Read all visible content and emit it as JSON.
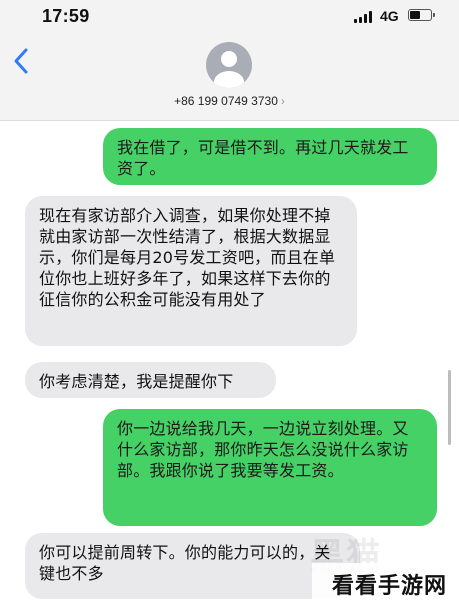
{
  "status_bar": {
    "time": "17:59",
    "network": "4G",
    "battery_level": 0.55
  },
  "header": {
    "contact": "+86 199 0749 3730",
    "chevron": "›"
  },
  "messages": [
    {
      "direction": "sent",
      "text": "我在借了，可是借不到。再过几天就发工资了。"
    },
    {
      "direction": "received",
      "text": "现在有家访部介入调查，如果你处理不掉就由家访部一次性结清了，根据大数据显示，你们是每月20号发工资吧，而且在单位你也上班好多年了，如果这样下去你的征信你的公积金可能没有用处了"
    },
    {
      "direction": "received",
      "text": "你考虑清楚，我是提醒你下"
    },
    {
      "direction": "sent",
      "text": "你一边说给我几天，一边说立刻处理。又什么家访部，那你昨天怎么没说什么家访部。我跟你说了我要等发工资。"
    },
    {
      "direction": "received",
      "text": "你可以提前周转下。你的能力可以的，关键也不多"
    }
  ],
  "watermark": {
    "faint": "黑猫",
    "label": "看看手游网"
  },
  "colors": {
    "sent_bubble": "#45d165",
    "received_bubble": "#e9e9eb",
    "header_bg": "#f3f3f3",
    "ios_blue": "#2f7cf6"
  }
}
